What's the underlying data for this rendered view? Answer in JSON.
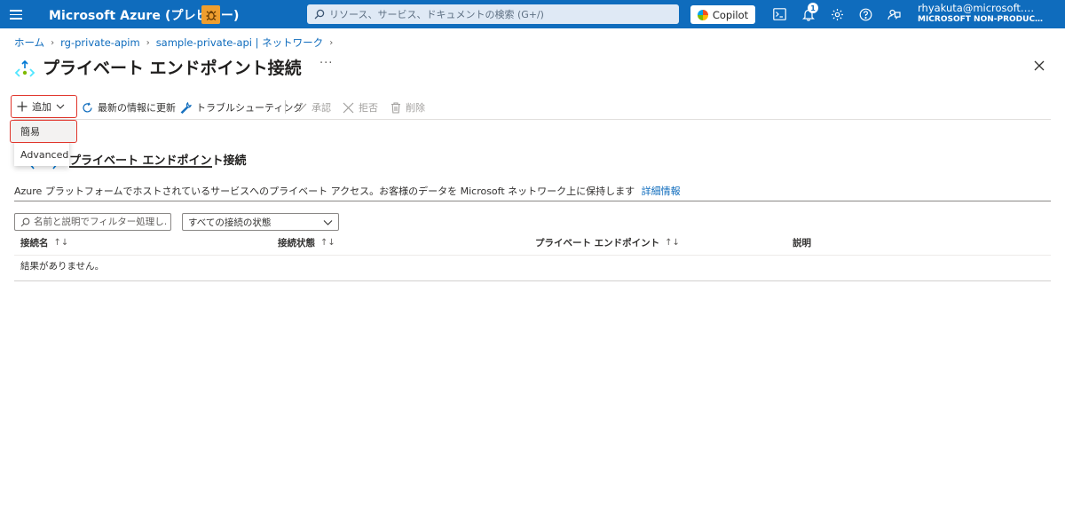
{
  "topbar": {
    "brand": "Microsoft Azure (プレビュー)",
    "search_placeholder": "リソース、サービス、ドキュメントの検索 (G+/)",
    "copilot_label": "Copilot",
    "notification_count": "1",
    "user_name": "rhyakuta@microsoft.…",
    "user_org": "MICROSOFT NON-PRODUC…",
    "icons": [
      "menu-icon",
      "bug-icon",
      "search-icon",
      "terminal-icon",
      "bell-icon",
      "gear-icon",
      "help-icon",
      "feedback-icon"
    ],
    "colors": {
      "bar": "#0f6cbd",
      "bug_button": "#ee9e2f"
    }
  },
  "breadcrumb": [
    "ホーム",
    "rg-private-apim",
    "sample-private-api | ネットワーク"
  ],
  "page": {
    "title": "プライベート エンドポイント接続",
    "more_label": "···"
  },
  "toolbar": {
    "add_label": "追加",
    "refresh_label": "最新の情報に更新",
    "troubleshoot_label": "トラブルシューティング",
    "approve_label": "承認",
    "reject_label": "拒否",
    "delete_label": "削除"
  },
  "add_menu": {
    "items": [
      {
        "label": "簡易",
        "highlighted": true
      },
      {
        "label": "Advanced",
        "highlighted": false
      }
    ]
  },
  "tab": {
    "label": "プライベート エンドポイント接続"
  },
  "description": {
    "text": "Azure プラットフォームでホストされているサービスへのプライベート アクセス。お客様のデータを Microsoft ネットワーク上に保持します",
    "link": "詳細情報"
  },
  "filters": {
    "name_placeholder": "名前と説明でフィルター処理し…",
    "status_select": "すべての接続の状態"
  },
  "table": {
    "columns": [
      {
        "label": "接続名",
        "sort": "↑↓"
      },
      {
        "label": "接続状態",
        "sort": "↑↓"
      },
      {
        "label": "プライベート エンドポイント",
        "sort": "↑↓"
      },
      {
        "label": "説明",
        "sort": ""
      }
    ],
    "empty_message": "結果がありません。"
  },
  "accent": {
    "highlight_border": "#e0352b",
    "link": "#0f6cbd"
  }
}
